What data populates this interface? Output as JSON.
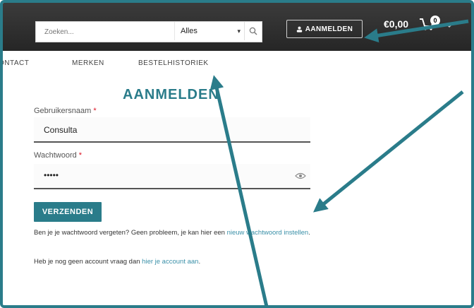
{
  "header": {
    "search_placeholder": "Zoeken...",
    "search_scope": "Alles",
    "login_label": "AANMELDEN",
    "cart_total": "€0,00",
    "cart_count": "0"
  },
  "nav": {
    "items": [
      "ONTACT",
      "MERKEN",
      "BESTELHISTORIEK"
    ]
  },
  "form": {
    "title": "AANMELDEN",
    "username_label": "Gebruikersnaam",
    "username_value": "Consulta",
    "password_label": "Wachtwoord",
    "password_value": "•••••",
    "required_mark": "*",
    "submit_label": "VERZENDEN",
    "forgot_text": "Ben je je wachtwoord vergeten? Geen probleem, je kan hier een ",
    "forgot_link": "nieuw wachtwoord instellen",
    "forgot_end": ".",
    "register_text": "Heb je nog geen account vraag dan ",
    "register_link": "hier je account aan",
    "register_end": "."
  },
  "colors": {
    "accent": "#2a7c8a",
    "topbar": "#2f2f2f",
    "link": "#3a90a8"
  }
}
